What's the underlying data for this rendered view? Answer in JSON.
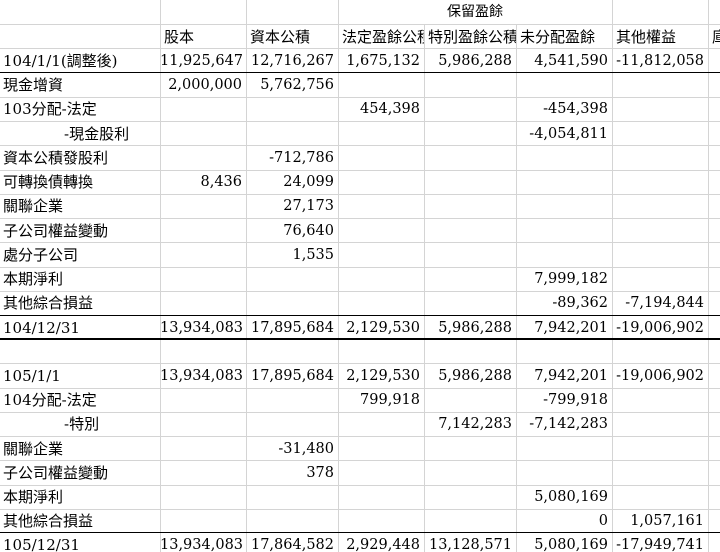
{
  "header": {
    "group_label": "保留盈餘",
    "columns": [
      "",
      "股本",
      "資本公積",
      "法定盈餘公積",
      "特別盈餘公積",
      "未分配盈餘",
      "其他權益",
      "庫"
    ]
  },
  "rows": [
    {
      "label": "104/1/1(調整後)",
      "indent": false,
      "values": [
        "11,925,647",
        "12,716,267",
        "1,675,132",
        "5,986,288",
        "4,541,590",
        "-11,812,058"
      ]
    },
    {
      "label": "現金增資",
      "indent": false,
      "values": [
        "2,000,000",
        "5,762,756",
        "",
        "",
        "",
        ""
      ]
    },
    {
      "label": "103分配-法定",
      "indent": false,
      "values": [
        "",
        "",
        "454,398",
        "",
        "-454,398",
        ""
      ]
    },
    {
      "label": "-現金股利",
      "indent": true,
      "values": [
        "",
        "",
        "",
        "",
        "-4,054,811",
        ""
      ]
    },
    {
      "label": "資本公積發股利",
      "indent": false,
      "values": [
        "",
        "-712,786",
        "",
        "",
        "",
        ""
      ]
    },
    {
      "label": "可轉換債轉換",
      "indent": false,
      "values": [
        "8,436",
        "24,099",
        "",
        "",
        "",
        ""
      ]
    },
    {
      "label": "關聯企業",
      "indent": false,
      "values": [
        "",
        "27,173",
        "",
        "",
        "",
        ""
      ]
    },
    {
      "label": "子公司權益變動",
      "indent": false,
      "values": [
        "",
        "76,640",
        "",
        "",
        "",
        ""
      ]
    },
    {
      "label": "處分子公司",
      "indent": false,
      "values": [
        "",
        "1,535",
        "",
        "",
        "",
        ""
      ]
    },
    {
      "label": "本期淨利",
      "indent": false,
      "values": [
        "",
        "",
        "",
        "",
        "7,999,182",
        ""
      ]
    },
    {
      "label": "其他綜合損益",
      "indent": false,
      "values": [
        "",
        "",
        "",
        "",
        "-89,362",
        "-7,194,844"
      ]
    },
    {
      "label": "104/12/31",
      "indent": false,
      "values": [
        "13,934,083",
        "17,895,684",
        "2,129,530",
        "5,986,288",
        "7,942,201",
        "-19,006,902"
      ]
    },
    {
      "label": "",
      "indent": false,
      "values": [
        "",
        "",
        "",
        "",
        "",
        ""
      ]
    },
    {
      "label": "105/1/1",
      "indent": false,
      "values": [
        "13,934,083",
        "17,895,684",
        "2,129,530",
        "5,986,288",
        "7,942,201",
        "-19,006,902"
      ]
    },
    {
      "label": "104分配-法定",
      "indent": false,
      "values": [
        "",
        "",
        "799,918",
        "",
        "-799,918",
        ""
      ]
    },
    {
      "label": "-特別",
      "indent": true,
      "values": [
        "",
        "",
        "",
        "7,142,283",
        "-7,142,283",
        ""
      ]
    },
    {
      "label": "關聯企業",
      "indent": false,
      "values": [
        "",
        "-31,480",
        "",
        "",
        "",
        ""
      ]
    },
    {
      "label": "子公司權益變動",
      "indent": false,
      "values": [
        "",
        "378",
        "",
        "",
        "",
        ""
      ]
    },
    {
      "label": "本期淨利",
      "indent": false,
      "values": [
        "",
        "",
        "",
        "",
        "5,080,169",
        ""
      ]
    },
    {
      "label": "其他綜合損益",
      "indent": false,
      "values": [
        "",
        "",
        "",
        "",
        "0",
        "1,057,161"
      ]
    },
    {
      "label": "105/12/31",
      "indent": false,
      "values": [
        "13,934,083",
        "17,864,582",
        "2,929,448",
        "13,128,571",
        "5,080,169",
        "-17,949,741"
      ]
    }
  ]
}
